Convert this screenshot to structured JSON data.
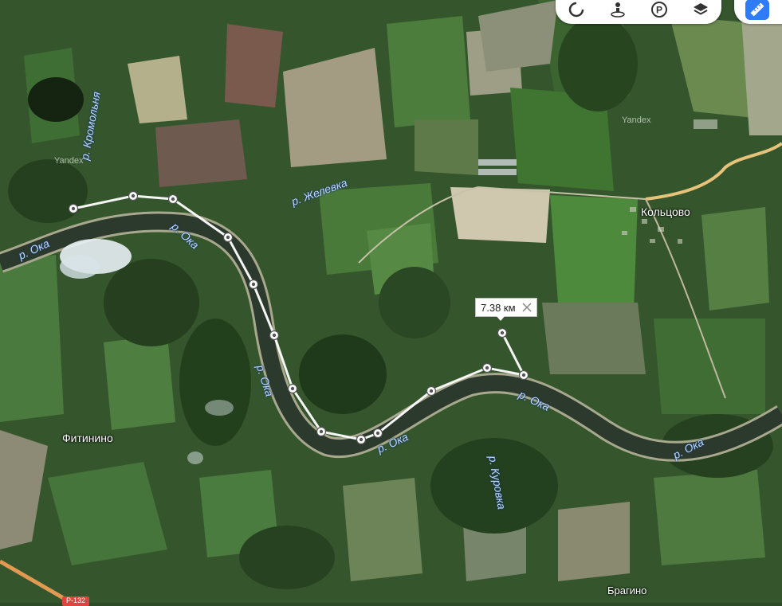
{
  "map": {
    "type": "satellite",
    "colors": {
      "ruler_line": "#ffffff",
      "river": "#2b3a2c",
      "route_highlight": "#2e7cf6"
    }
  },
  "toolbar": {
    "buttons": [
      {
        "name": "traffic-icon"
      },
      {
        "name": "panorama-icon"
      },
      {
        "name": "parking-icon",
        "label": "P"
      },
      {
        "name": "layers-icon"
      }
    ]
  },
  "ruler": {
    "distance_label": "7.38 км"
  },
  "labels": {
    "rivers": {
      "oka_1": "р. Ока",
      "oka_2": "р. Ока",
      "oka_3": "р. Ока",
      "oka_4": "р. Ока",
      "oka_5": "р. Ока",
      "kromolnya": "р. Кромольня",
      "zhelevka": "р. Желевка",
      "kurovka": "р. Куровка"
    },
    "towns": {
      "koltsovo": "Кольцово",
      "fitinino": "Фитинино",
      "bragino": "Брагино"
    },
    "watermarks": {
      "w1": "Yandex",
      "w2": "Yandex"
    },
    "road_number": "Р-132"
  }
}
